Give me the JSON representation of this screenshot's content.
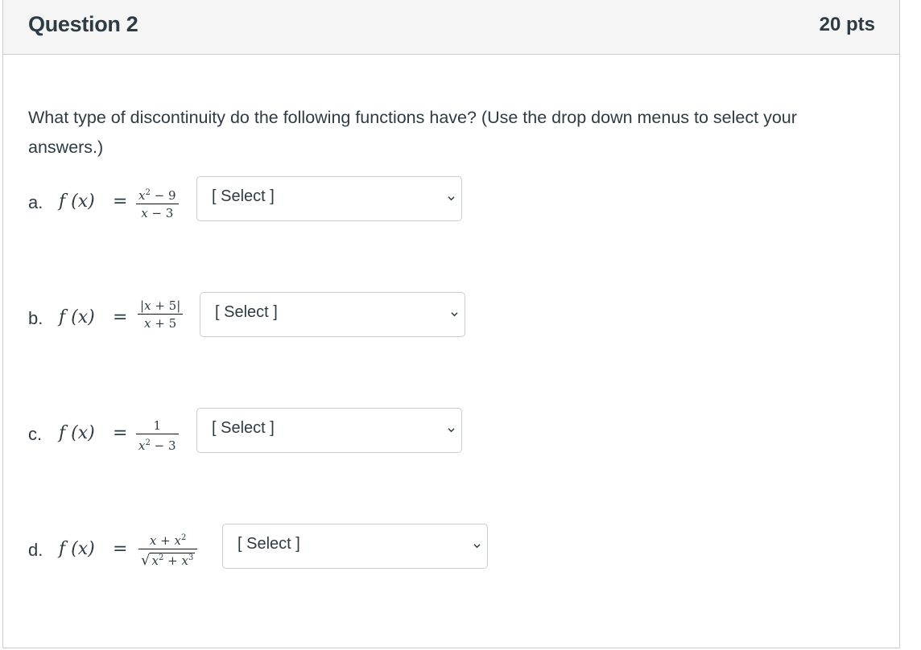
{
  "question": {
    "title": "Question 2",
    "points": "20 pts",
    "prompt": "What type of discontinuity do the following functions have? (Use the drop down menus to select your answers.)"
  },
  "items": [
    {
      "label": "a.",
      "lhs": "f (x)",
      "eq": "=",
      "numerator": "x² − 9",
      "denominator": "x − 3",
      "select": "[ Select ]"
    },
    {
      "label": "b.",
      "lhs": "f (x)",
      "eq": "=",
      "numerator": "|x + 5|",
      "denominator": "x + 5",
      "select": "[ Select ]"
    },
    {
      "label": "c.",
      "lhs": "f (x)",
      "eq": "=",
      "numerator": "1",
      "denominator": "x² − 3",
      "select": "[ Select ]"
    },
    {
      "label": "d.",
      "lhs": "f (x)",
      "eq": "=",
      "numerator": "x + x²",
      "denominator": "√(x² + x³)",
      "select": "[ Select ]"
    }
  ],
  "icons": {
    "dropdown": "chevron-down-icon"
  },
  "colors": {
    "header_bg": "#f5f5f5",
    "border": "#c7cdd1",
    "text": "#2d3b45"
  }
}
